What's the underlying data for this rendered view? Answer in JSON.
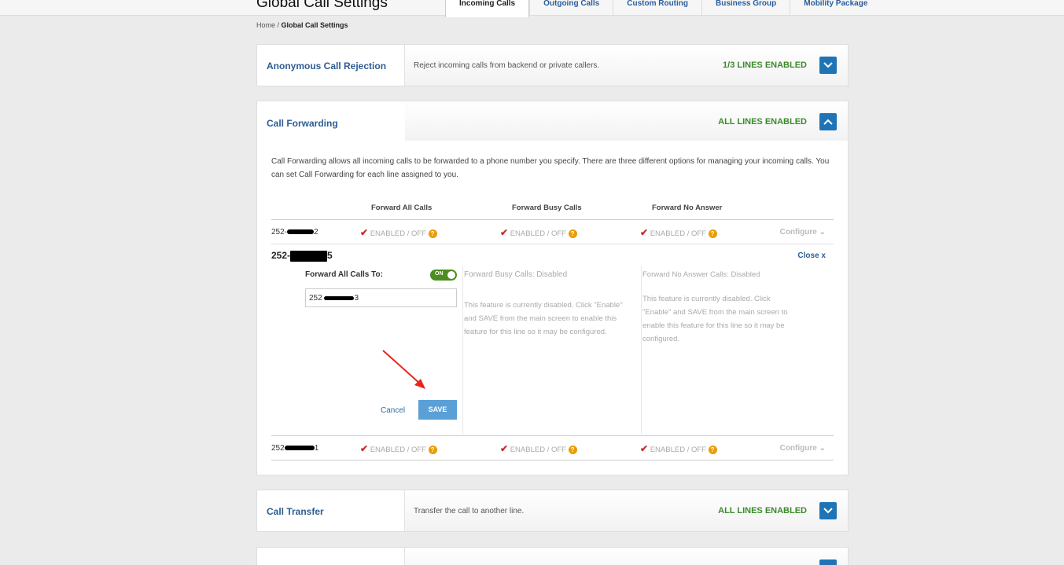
{
  "header": {
    "title": "Global Call Settings",
    "tabs": [
      {
        "label": "Incoming Calls",
        "active": true
      },
      {
        "label": "Outgoing Calls"
      },
      {
        "label": "Custom Routing"
      },
      {
        "label": "Business Group"
      },
      {
        "label": "Mobility Package"
      }
    ]
  },
  "breadcrumb": {
    "home": "Home",
    "separator": " / ",
    "current": "Global Call Settings"
  },
  "colors": {
    "brand_blue": "#1f74b5",
    "status_green": "#3a8a2a",
    "check_red": "#c0332b",
    "help_orange": "#e89c0c",
    "switch_green": "#4d8c1e",
    "save_blue": "#5aa0d6"
  },
  "anonymous": {
    "title": "Anonymous Call Rejection",
    "description": "Reject incoming calls from backend or private callers.",
    "status": "1/3 LINES ENABLED",
    "icon": "chevron-down-icon"
  },
  "call_forwarding": {
    "title": "Call Forwarding",
    "status": "ALL LINES ENABLED",
    "icon": "chevron-up-icon",
    "intro": "Call Forwarding allows all incoming calls to be forwarded to a phone number you specify. There are three different options for managing your incoming calls. You can set Call Forwarding for each line assigned to you.",
    "columns": [
      "Forward All Calls",
      "Forward Busy Calls",
      "Forward No Answer"
    ],
    "status_text": "ENABLED / OFF",
    "help_glyph": "?",
    "configure": "Configure",
    "lines": [
      {
        "prefix": "252-",
        "suffix": "2"
      },
      {
        "prefix": "252-",
        "suffix": "5"
      },
      {
        "prefix": "252",
        "suffix": "1"
      }
    ],
    "expanded": {
      "close_label": "Close x",
      "forward_all_label": "Forward All Calls To:",
      "switch_label": "ON",
      "input_prefix": "252",
      "input_suffix": "3",
      "busy_title": "Forward Busy Calls: Disabled",
      "busy_body": "This feature is currently disabled. Click \"Enable\" and SAVE from the main screen to enable this feature for this line so it may be configured.",
      "noanswer_title": "Forward No Answer Calls: Disabled",
      "noanswer_body": "This feature is currently disabled. Click \"Enable\" and SAVE from the main screen to enable this feature for this line so it may be configured.",
      "cancel_label": "Cancel",
      "save_label": "SAVE"
    }
  },
  "call_transfer": {
    "title": "Call Transfer",
    "description": "Transfer the call to another line.",
    "status": "ALL LINES ENABLED",
    "icon": "chevron-down-icon"
  }
}
